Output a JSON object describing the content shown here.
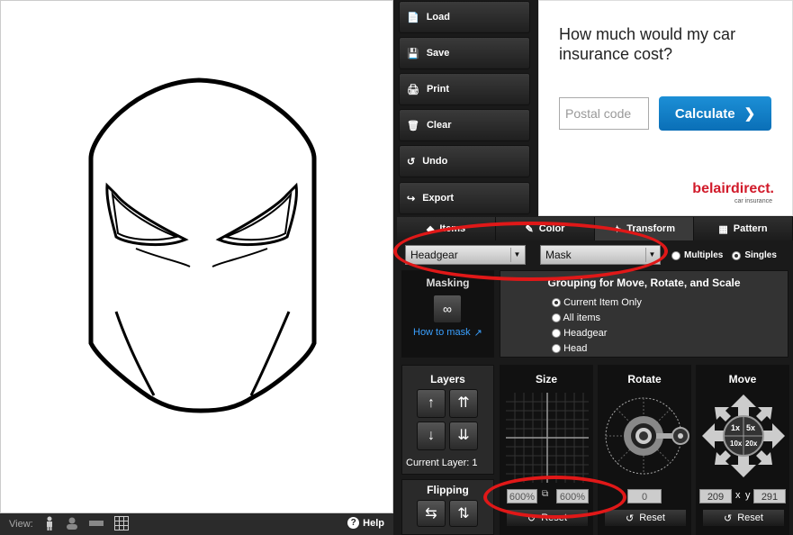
{
  "toolbar": {
    "load": "Load",
    "save": "Save",
    "print": "Print",
    "clear": "Clear",
    "undo": "Undo",
    "export": "Export"
  },
  "ad": {
    "question": "How much would my car insurance cost?",
    "postal_placeholder": "Postal code",
    "calculate": "Calculate",
    "brand": "belairdirect.",
    "brand_sub": "car insurance"
  },
  "tabs": [
    "Items",
    "Color",
    "Transform",
    "Pattern"
  ],
  "selects": {
    "group": "Headgear",
    "item": "Mask"
  },
  "mode": {
    "multiples": "Multiples",
    "singles": "Singles"
  },
  "masking": {
    "title": "Masking",
    "link": "How to mask"
  },
  "grouping": {
    "title": "Grouping for Move, Rotate, and Scale",
    "options": [
      "Current Item Only",
      "All items",
      "Headgear",
      "Head"
    ]
  },
  "layers": {
    "title": "Layers",
    "current_label": "Current Layer:",
    "current_value": "1"
  },
  "flipping": {
    "title": "Flipping"
  },
  "size": {
    "title": "Size",
    "w": "600",
    "h": "600",
    "unit": "%",
    "reset": "Reset"
  },
  "rotate": {
    "title": "Rotate",
    "value": "0",
    "reset": "Reset"
  },
  "move": {
    "title": "Move",
    "x": "209",
    "y": "291",
    "x_label": "x",
    "y_label": "y",
    "reset": "Reset",
    "steps": [
      "1x",
      "5x",
      "10x",
      "20x"
    ]
  },
  "viewbar": {
    "label": "View:",
    "help": "Help"
  },
  "colors": {
    "annotation": "#e01818",
    "panel": "#2a2a2a",
    "ad_button": "#0a6fb7",
    "brand": "#d11a2a"
  }
}
